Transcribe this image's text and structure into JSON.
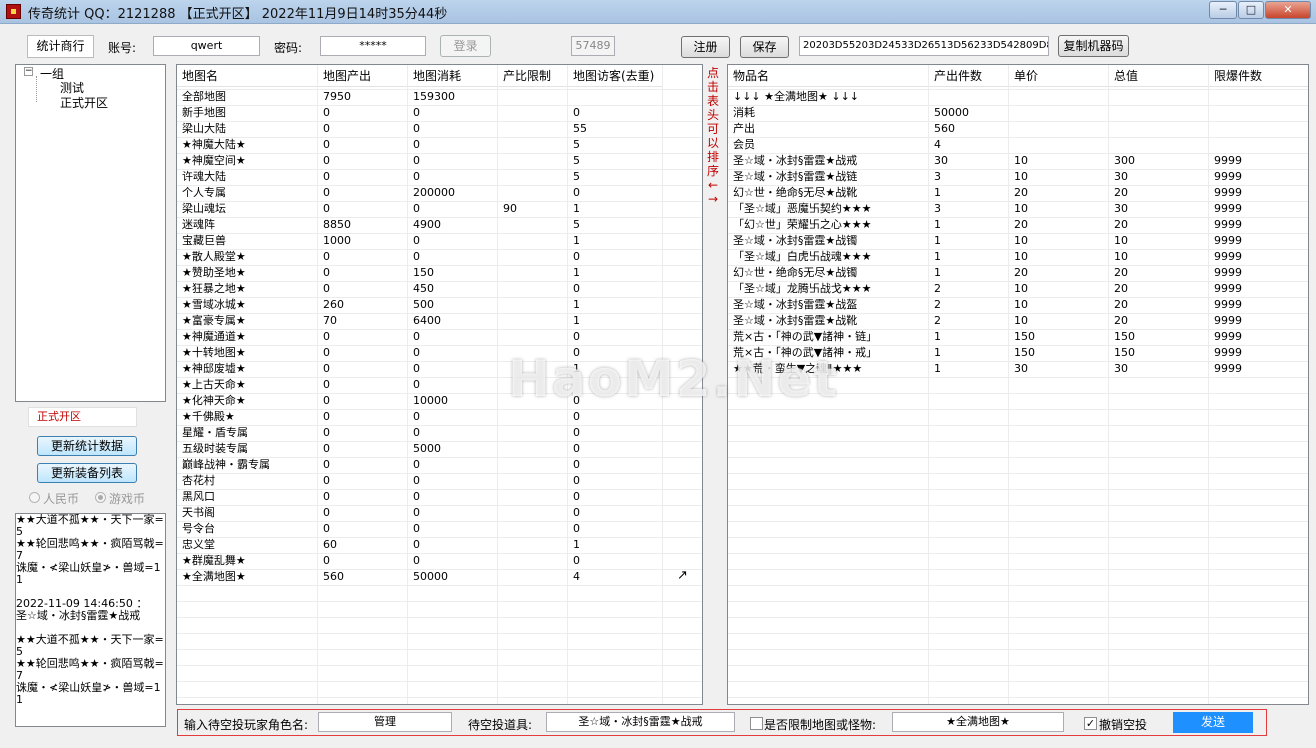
{
  "window": {
    "title": "传奇统计 QQ：2121288 【正式开区】 2022年11月9日14时35分44秒",
    "controls": [
      "─",
      "□",
      "✕"
    ]
  },
  "toolbar": {
    "tab": "统计商行",
    "account_label": "账号:",
    "account_value": "qwert",
    "password_label": "密码:",
    "password_value": "*****",
    "login": "登录",
    "port": "57489",
    "register": "注册",
    "save": "保存",
    "machine_code": "20203D55203D24533D26513D56233D542809D874A",
    "copy_machine": "复制机器码"
  },
  "tree": {
    "root": "一组",
    "children": [
      "测试",
      "正式开区"
    ]
  },
  "left": {
    "selected_server": "正式开区",
    "update_stats": "更新统计数据",
    "update_equip": "更新装备列表",
    "radio_rmb": "人民币",
    "radio_game": "游戏币"
  },
  "log_lines": [
    "★★大道不孤★★・天下一家=5",
    "★★轮回悲鸣★★・疯陌骂戟=7",
    "诛魔・≮梁山妖皇≯・兽域=11",
    "",
    "2022-11-09 14:46:50 ：",
    "圣☆域・冰封§雷霆★战戒",
    "",
    "★★大道不孤★★・天下一家=5",
    "★★轮回悲鸣★★・疯陌骂戟=7",
    "诛魔・≮梁山妖皇≯・兽域=11"
  ],
  "maps": {
    "headers": [
      "地图名",
      "地图产出",
      "地图消耗",
      "产比限制",
      "地图访客(去重)"
    ],
    "rows": [
      [
        "全部地图",
        "7950",
        "159300",
        "",
        ""
      ],
      [
        "新手地图",
        "0",
        "0",
        "",
        "0"
      ],
      [
        "梁山大陆",
        "0",
        "0",
        "",
        "55"
      ],
      [
        "★神魔大陆★",
        "0",
        "0",
        "",
        "5"
      ],
      [
        "★神魔空间★",
        "0",
        "0",
        "",
        "5"
      ],
      [
        "许魂大陆",
        "0",
        "0",
        "",
        "5"
      ],
      [
        "个人专属",
        "0",
        "200000",
        "",
        "0"
      ],
      [
        "梁山魂坛",
        "0",
        "0",
        "90",
        "1"
      ],
      [
        "迷魂阵",
        "8850",
        "4900",
        "",
        "5"
      ],
      [
        "宝藏巨兽",
        "1000",
        "0",
        "",
        "1"
      ],
      [
        "★散人殿堂★",
        "0",
        "0",
        "",
        "0"
      ],
      [
        "★赞助圣地★",
        "0",
        "150",
        "",
        "1"
      ],
      [
        "★狂暴之地★",
        "0",
        "450",
        "",
        "0"
      ],
      [
        "★雪域冰城★",
        "260",
        "500",
        "",
        "1"
      ],
      [
        "★富豪专属★",
        "70",
        "6400",
        "",
        "1"
      ],
      [
        "★神魔通道★",
        "0",
        "0",
        "",
        "0"
      ],
      [
        "★十转地图★",
        "0",
        "0",
        "",
        "0"
      ],
      [
        "★神邸废墟★",
        "0",
        "0",
        "",
        "1"
      ],
      [
        "★上古天命★",
        "0",
        "0",
        "",
        ""
      ],
      [
        "★化神天命★",
        "0",
        "10000",
        "",
        "0"
      ],
      [
        "★千佛殿★",
        "0",
        "0",
        "",
        "0"
      ],
      [
        "星耀・盾专属",
        "0",
        "0",
        "",
        "0"
      ],
      [
        "五级时装专属",
        "0",
        "5000",
        "",
        "0"
      ],
      [
        "巅峰战神・霸专属",
        "0",
        "0",
        "",
        "0"
      ],
      [
        "杏花村",
        "0",
        "0",
        "",
        "0"
      ],
      [
        "黑风口",
        "0",
        "0",
        "",
        "0"
      ],
      [
        "天书阁",
        "0",
        "0",
        "",
        "0"
      ],
      [
        "号令台",
        "0",
        "0",
        "",
        "0"
      ],
      [
        "忠义堂",
        "60",
        "0",
        "",
        "1"
      ],
      [
        "★群魔乱舞★",
        "0",
        "0",
        "",
        "0"
      ],
      [
        "★全满地图★",
        "560",
        "50000",
        "",
        "4"
      ]
    ]
  },
  "sort_hint": "点击表头可以排序←→",
  "items": {
    "headers": [
      "物品名",
      "产出件数",
      "单价",
      "总值",
      "限爆件数"
    ],
    "rows": [
      [
        "↓↓↓ ★全满地图★ ↓↓↓",
        "",
        "",
        "",
        ""
      ],
      [
        "消耗",
        "50000",
        "",
        "",
        ""
      ],
      [
        "产出",
        "560",
        "",
        "",
        ""
      ],
      [
        "会员",
        "4",
        "",
        "",
        ""
      ],
      [
        "圣☆域・冰封§雷霆★战戒",
        "30",
        "10",
        "300",
        "9999"
      ],
      [
        "圣☆域・冰封§雷霆★战链",
        "3",
        "10",
        "30",
        "9999"
      ],
      [
        "幻☆世・绝命§无尽★战靴",
        "1",
        "20",
        "20",
        "9999"
      ],
      [
        "「圣☆域」恶魔卐契约★★★",
        "3",
        "10",
        "30",
        "9999"
      ],
      [
        "「幻☆世」荣耀卐之心★★★",
        "1",
        "20",
        "20",
        "9999"
      ],
      [
        "圣☆域・冰封§雷霆★战镯",
        "1",
        "10",
        "10",
        "9999"
      ],
      [
        "「圣☆域」白虎卐战魂★★★",
        "1",
        "10",
        "10",
        "9999"
      ],
      [
        "幻☆世・绝命§无尽★战镯",
        "1",
        "20",
        "20",
        "9999"
      ],
      [
        "「圣☆域」龙腾卐战戈★★★",
        "2",
        "10",
        "20",
        "9999"
      ],
      [
        "圣☆域・冰封§雷霆★战盔",
        "2",
        "10",
        "20",
        "9999"
      ],
      [
        "圣☆域・冰封§雷霆★战靴",
        "2",
        "10",
        "20",
        "9999"
      ],
      [
        "荒×古・「神の武▼諸神・链」",
        "1",
        "150",
        "150",
        "9999"
      ],
      [
        "荒×古・「神の武▼諸神・戒」",
        "1",
        "150",
        "150",
        "9999"
      ],
      [
        "★★荒・蛮生▼之魂‖★★★",
        "1",
        "30",
        "30",
        "9999"
      ]
    ]
  },
  "bottom": {
    "player_label": "输入待空投玩家角色名:",
    "player_value": "管理",
    "item_label": "待空投道具:",
    "item_value": "圣☆域・冰封§雷霆★战戒",
    "limit_label": "是否限制地图或怪物:",
    "map_value": "★全满地图★",
    "cancel_label": "撤销空投",
    "send": "发送"
  },
  "watermark": "HaoM2.Net"
}
